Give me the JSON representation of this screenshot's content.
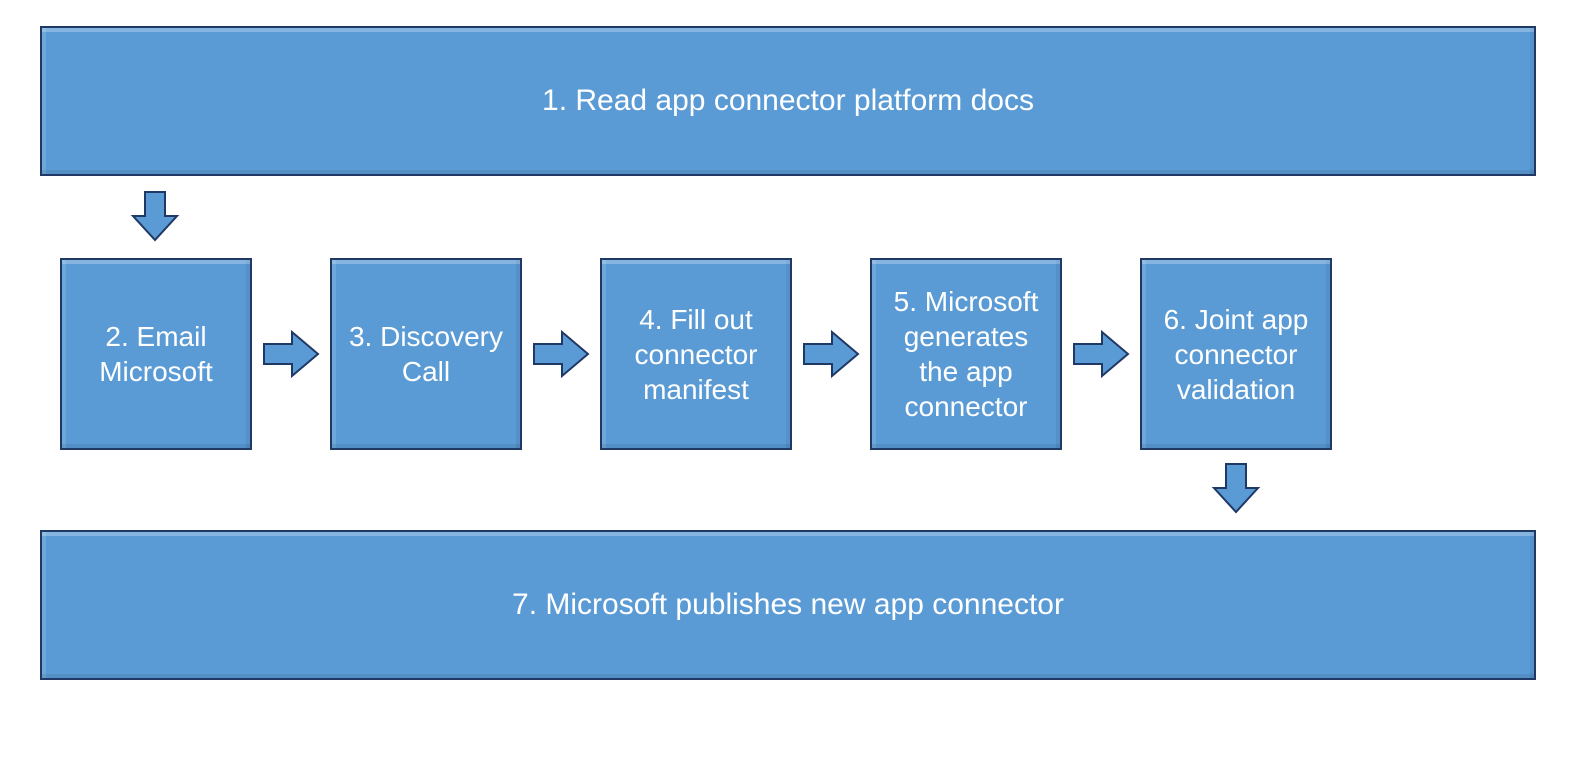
{
  "colors": {
    "fill": "#5B9BD5",
    "border": "#1F3864",
    "text": "#FFFFFF"
  },
  "steps": {
    "s1": "1. Read app connector platform docs",
    "s2": "2. Email Microsoft",
    "s3": "3. Discovery Call",
    "s4": "4. Fill out connector manifest",
    "s5": "5. Microsoft generates the app connector",
    "s6": "6. Joint app connector validation",
    "s7": "7. Microsoft publishes new app connector"
  },
  "flow": [
    {
      "from": "s1",
      "to": "s2",
      "dir": "down"
    },
    {
      "from": "s2",
      "to": "s3",
      "dir": "right"
    },
    {
      "from": "s3",
      "to": "s4",
      "dir": "right"
    },
    {
      "from": "s5",
      "to": "s6",
      "dir": "right"
    },
    {
      "from": "s4",
      "to": "s5",
      "dir": "right"
    },
    {
      "from": "s6",
      "to": "s7",
      "dir": "down"
    }
  ]
}
